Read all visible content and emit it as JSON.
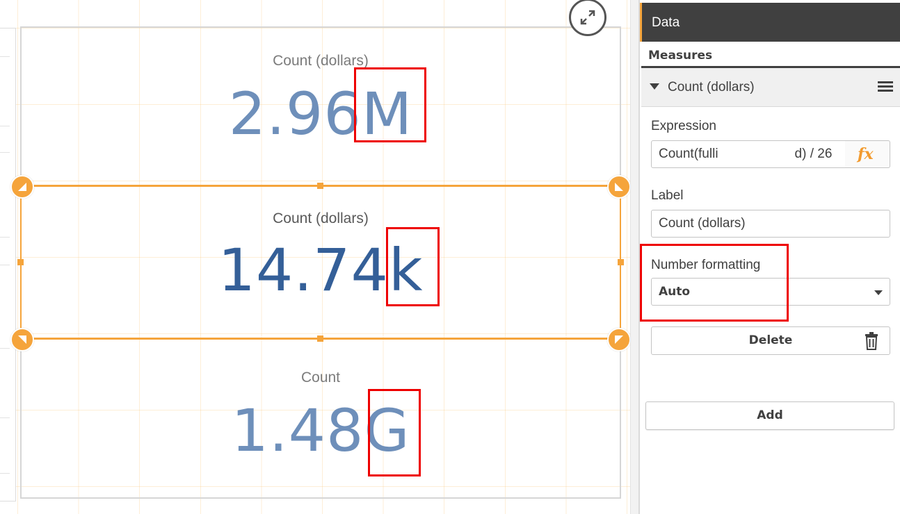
{
  "kpis": [
    {
      "label": "Count (dollars)",
      "value": "2.96M"
    },
    {
      "label": "Count (dollars)",
      "value": "14.74k"
    },
    {
      "label": "Count",
      "value": "1.48G"
    }
  ],
  "panel": {
    "header": "Data",
    "measures_title": "Measures",
    "measure_item": {
      "name": "Count (dollars)"
    },
    "expression": {
      "label": "Expression",
      "value_start": "Count(fulli",
      "value_end": "d) / 26",
      "fx_label": "fx"
    },
    "label_field": {
      "label": "Label",
      "value": "Count (dollars)"
    },
    "number_formatting": {
      "label": "Number formatting",
      "value": "Auto"
    },
    "delete_label": "Delete",
    "add_label": "Add"
  },
  "colors": {
    "accent": "#f5a43b",
    "kpi_value": "#6e8fba",
    "kpi_value_selected": "#345f98",
    "highlight": "#e00000",
    "panel_header_bg": "#404040"
  },
  "icons": {
    "expand": "expand-icon",
    "menu": "hamburger-menu-icon",
    "trash": "trash-icon",
    "caret": "chevron-down-icon",
    "expand_toggle": "triangle-down-icon"
  }
}
